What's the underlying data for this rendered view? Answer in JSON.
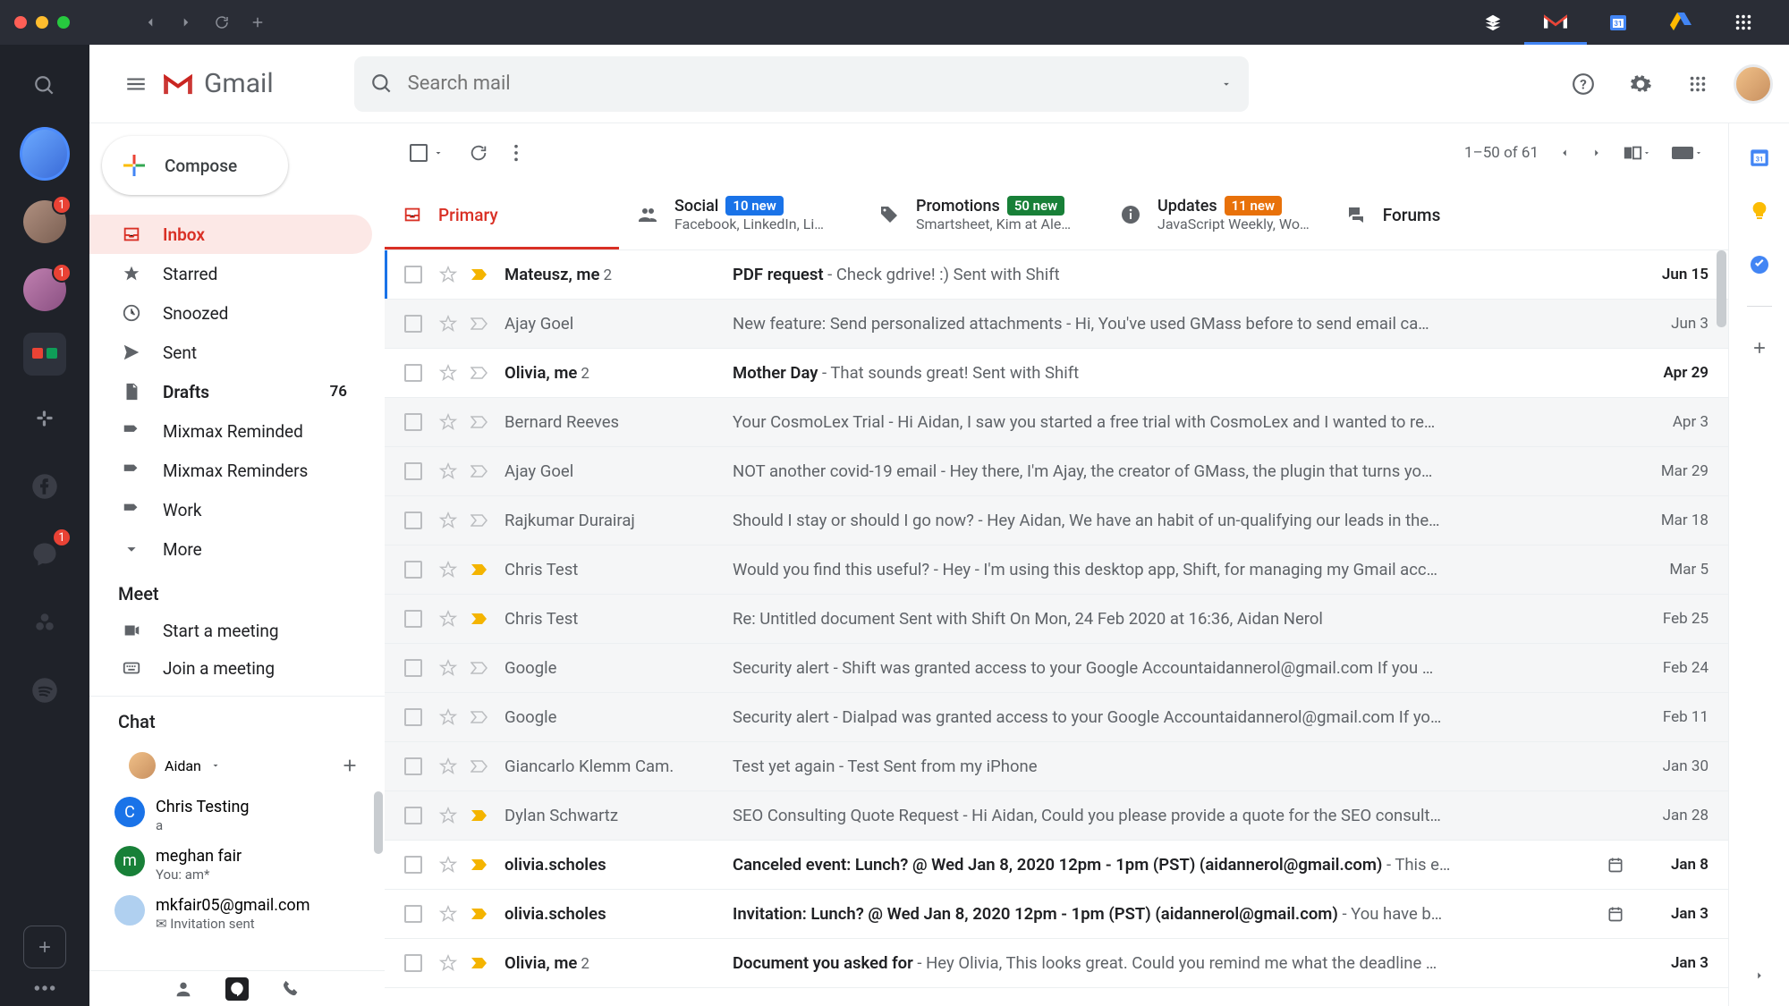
{
  "topbar": {
    "apps": [
      "stack",
      "gmail",
      "calendar",
      "drive",
      "apps"
    ]
  },
  "shift_rail": {
    "badges": {
      "acct2": "1",
      "acct3": "1",
      "messenger": "1"
    }
  },
  "header": {
    "logo_text": "Gmail",
    "search_placeholder": "Search mail"
  },
  "sidebar": {
    "compose": "Compose",
    "items": [
      {
        "label": "Inbox",
        "active": true
      },
      {
        "label": "Starred"
      },
      {
        "label": "Snoozed"
      },
      {
        "label": "Sent"
      },
      {
        "label": "Drafts",
        "count": "76",
        "bold": true
      },
      {
        "label": "Mixmax Reminded"
      },
      {
        "label": "Mixmax Reminders"
      },
      {
        "label": "Work"
      },
      {
        "label": "More"
      }
    ],
    "meet_title": "Meet",
    "meet": [
      {
        "label": "Start a meeting"
      },
      {
        "label": "Join a meeting"
      }
    ],
    "chat_title": "Chat",
    "chat_user": "Aidan",
    "chats": [
      {
        "name": "Chris Testing",
        "sub": "a",
        "color": "#1a73e8",
        "initial": "C"
      },
      {
        "name": "meghan fair",
        "sub": "You: am*",
        "color": "#188038",
        "initial": "m"
      },
      {
        "name": "mkfair05@gmail.com",
        "sub": "✉ Invitation sent",
        "color": "#b0d0f0",
        "initial": ""
      }
    ]
  },
  "toolbar": {
    "pagination": "1–50 of 61"
  },
  "tabs": {
    "primary": {
      "label": "Primary"
    },
    "social": {
      "label": "Social",
      "badge": "10 new",
      "sub": "Facebook, LinkedIn, Li…"
    },
    "promotions": {
      "label": "Promotions",
      "badge": "50 new",
      "sub": "Smartsheet, Kim at Ale…"
    },
    "updates": {
      "label": "Updates",
      "badge": "11 new",
      "sub": "JavaScript Weekly, Wo…"
    },
    "forums": {
      "label": "Forums"
    }
  },
  "emails": [
    {
      "unread": true,
      "imp": true,
      "sender": "Mateusz, me",
      "count": "2",
      "subject": "PDF request",
      "snippet": " - Check gdrive! :) Sent with Shift",
      "date": "Jun 15",
      "hl": true
    },
    {
      "unread": false,
      "imp": false,
      "sender": "Ajay Goel",
      "subject": "New feature: Send personalized attachments",
      "snippet": " - Hi, You've used GMass before to send email ca…",
      "date": "Jun 3"
    },
    {
      "unread": true,
      "imp": false,
      "sender": "Olivia, me",
      "count": "2",
      "subject": "Mother Day",
      "snippet": " - That sounds great! Sent with Shift",
      "date": "Apr 29"
    },
    {
      "unread": false,
      "imp": false,
      "sender": "Bernard Reeves",
      "subject": "Your CosmoLex Trial",
      "snippet": " - Hi Aidan, I saw you started a free trial with CosmoLex and I wanted to re…",
      "date": "Apr 3"
    },
    {
      "unread": false,
      "imp": false,
      "sender": "Ajay Goel",
      "subject": "NOT another covid-19 email",
      "snippet": " - Hey there, I'm Ajay, the creator of GMass, the plugin that turns yo…",
      "date": "Mar 29"
    },
    {
      "unread": false,
      "imp": false,
      "sender": "Rajkumar Durairaj",
      "subject": "Should I stay or should I go now?",
      "snippet": " - Hey Aidan, We have an habit of un-qualifying our leads in the…",
      "date": "Mar 18"
    },
    {
      "unread": false,
      "imp": true,
      "sender": "Chris Test",
      "subject": "Would you find this useful?",
      "snippet": " - Hey - I'm using this desktop app, Shift, for managing my Gmail acc…",
      "date": "Mar 5"
    },
    {
      "unread": false,
      "imp": true,
      "sender": "Chris Test",
      "subject": "Re: ",
      "snippet": "Untitled document Sent with Shift On Mon, 24 Feb 2020 at 16:36, Aidan Nerol <aidannerol…",
      "date": "Feb 25"
    },
    {
      "unread": false,
      "imp": false,
      "sender": "Google",
      "subject": "Security alert",
      "snippet": " - Shift was granted access to your Google Accountaidannerol@gmail.com If you …",
      "date": "Feb 24"
    },
    {
      "unread": false,
      "imp": false,
      "sender": "Google",
      "subject": "Security alert",
      "snippet": " - Dialpad was granted access to your Google Accountaidannerol@gmail.com If yo…",
      "date": "Feb 11"
    },
    {
      "unread": false,
      "imp": false,
      "sender": "Giancarlo Klemm Cam.",
      "subject": "Test yet again",
      "snippet": " - Test Sent from my iPhone",
      "date": "Jan 30"
    },
    {
      "unread": false,
      "imp": true,
      "sender": "Dylan Schwartz",
      "subject": "SEO Consulting Quote Request",
      "snippet": " - Hi Aidan, Could you please provide a quote for the SEO consult…",
      "date": "Jan 28"
    },
    {
      "unread": true,
      "imp": true,
      "sender": "olivia.scholes",
      "subject": "Canceled event: Lunch? @ Wed Jan 8, 2020 12pm - 1pm (PST) (aidannerol@gmail.com)",
      "snippet": " - This e…",
      "date": "Jan 8",
      "cal": true
    },
    {
      "unread": true,
      "imp": true,
      "sender": "olivia.scholes",
      "subject": "Invitation: Lunch? @ Wed Jan 8, 2020 12pm - 1pm (PST) (aidannerol@gmail.com)",
      "snippet": " - You have b…",
      "date": "Jan 3",
      "cal": true
    },
    {
      "unread": true,
      "imp": true,
      "sender": "Olivia, me",
      "count": "2",
      "subject": "Document you asked for",
      "snippet": " - Hey Olivia, This looks great. Could you remind me what the deadline …",
      "date": "Jan 3"
    }
  ]
}
